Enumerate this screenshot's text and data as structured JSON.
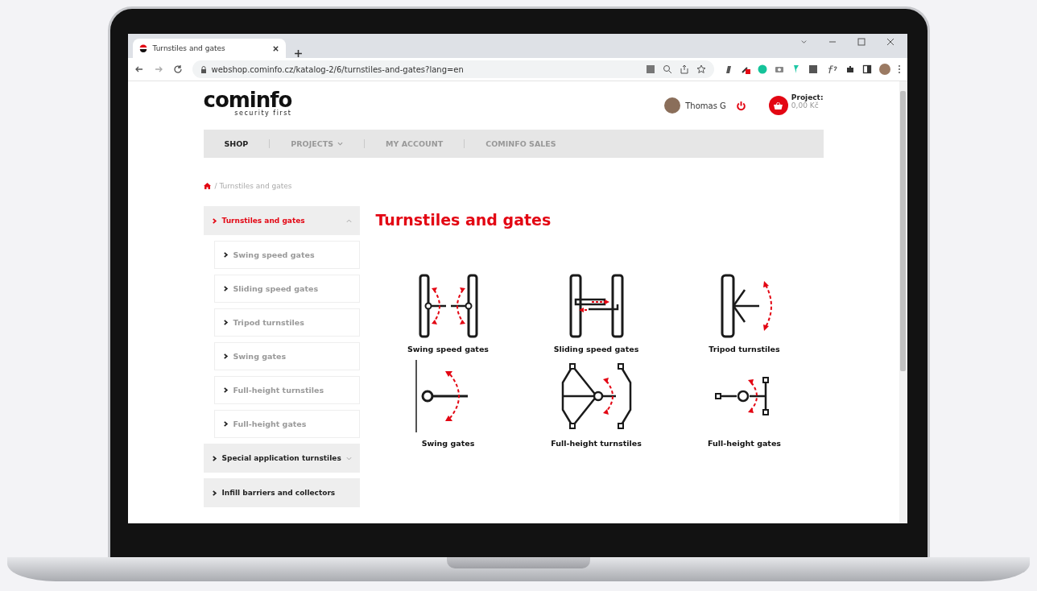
{
  "browser": {
    "tab": {
      "title": "Turnstiles and gates"
    },
    "url": "webshop.cominfo.cz/katalog-2/6/turnstiles-and-gates?lang=en"
  },
  "header": {
    "logo": {
      "name": "cominfo",
      "tagline": "security first"
    },
    "user": "Thomas G",
    "cart": {
      "label": "Project:",
      "total": "0,00 Kč"
    }
  },
  "nav": [
    {
      "label": "SHOP",
      "selected": true,
      "dropdown": false
    },
    {
      "label": "PROJECTS",
      "selected": false,
      "dropdown": true
    },
    {
      "label": "MY ACCOUNT",
      "selected": false,
      "dropdown": false
    },
    {
      "label": "COMINFO SALES",
      "selected": false,
      "dropdown": false
    }
  ],
  "breadcrumb": "/ Turnstiles and gates",
  "sidebar": {
    "items": [
      {
        "label": "Turnstiles and gates",
        "selected": true,
        "expandable": true,
        "expanded": true,
        "children": [
          {
            "label": "Swing speed gates",
            "selected": false
          },
          {
            "label": "Sliding speed gates",
            "selected": false
          },
          {
            "label": "Tripod turnstiles",
            "selected": false
          },
          {
            "label": "Swing gates",
            "selected": false
          },
          {
            "label": "Full-height turnstiles",
            "selected": false
          },
          {
            "label": "Full-height gates",
            "selected": false
          }
        ]
      },
      {
        "label": "Special application turnstiles",
        "selected": false,
        "expandable": true,
        "expanded": false
      },
      {
        "label": "Infill barriers and collectors",
        "selected": false,
        "expandable": false
      }
    ]
  },
  "content": {
    "title": "Turnstiles and gates",
    "categories": [
      {
        "label": "Swing speed gates",
        "kind": "swing"
      },
      {
        "label": "Sliding speed gates",
        "kind": "sliding"
      },
      {
        "label": "Tripod turnstiles",
        "kind": "tripod"
      },
      {
        "label": "Swing gates",
        "kind": "arm"
      },
      {
        "label": "Full-height turnstiles",
        "kind": "rotor"
      },
      {
        "label": "Full-height gates",
        "kind": "door"
      }
    ]
  }
}
